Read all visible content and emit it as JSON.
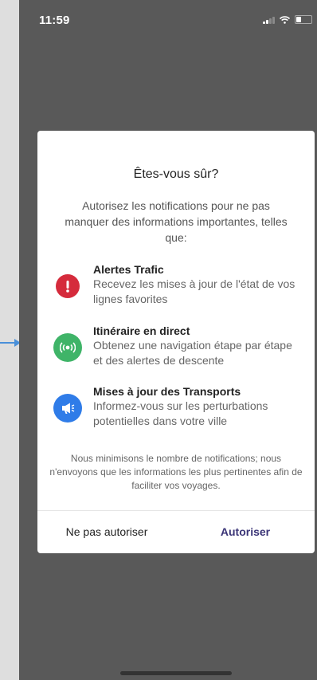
{
  "status_bar": {
    "time": "11:59"
  },
  "dialog": {
    "title": "Êtes-vous sûr?",
    "intro": "Autorisez les notifications pour ne pas manquer des informations importantes, telles que:",
    "features": [
      {
        "title": "Alertes Trafic",
        "description": "Recevez les mises à jour de l'état de vos lignes favorites",
        "icon": "exclamation-icon",
        "color": "#d52b3c"
      },
      {
        "title": "Itinéraire en direct",
        "description": "Obtenez une navigation étape par étape et des alertes de descente",
        "icon": "live-broadcast-icon",
        "color": "#3fb468"
      },
      {
        "title": "Mises à jour des Transports",
        "description": "Informez-vous sur les perturbations potentielles dans votre ville",
        "icon": "megaphone-icon",
        "color": "#2f7ce8"
      }
    ],
    "footnote": "Nous minimisons le nombre de notifications; nous n'envoyons que les informations les plus pertinentes afin de faciliter vos voyages.",
    "deny_label": "Ne pas autoriser",
    "allow_label": "Autoriser"
  },
  "colors": {
    "accent": "#3b3577",
    "overlay": "#595959",
    "arrow": "#4a90d9"
  }
}
